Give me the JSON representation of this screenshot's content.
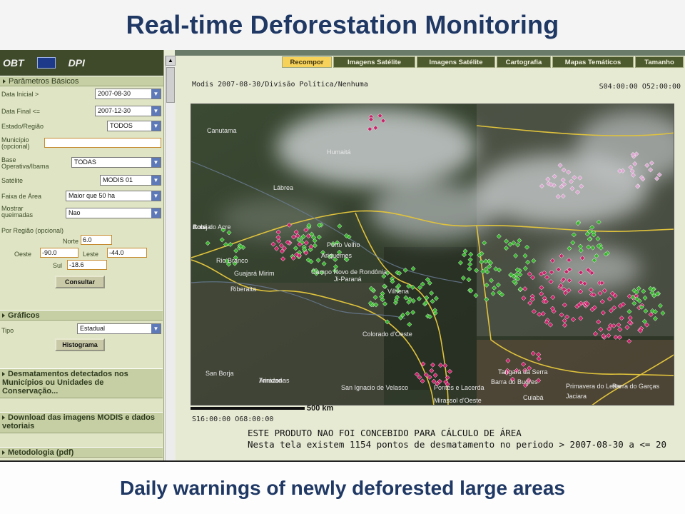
{
  "slide": {
    "title": "Real-time Deforestation Monitoring",
    "caption": "Daily warnings of newly deforested large areas"
  },
  "logos": [
    "OBT",
    "DPI"
  ],
  "left_panel": {
    "section_params": "Parâmetros Básicos",
    "fields": {
      "data_inicial_label": "Data Inicial  >",
      "data_inicial_value": "2007-08-30",
      "data_final_label": "Data Final  <=",
      "data_final_value": "2007-12-30",
      "estado_label": "Estado/Região",
      "estado_value": "TODOS",
      "municipio_label": "Município (opcional)",
      "municipio_value": "",
      "base_label": "Base Operativa/Ibama",
      "base_value": "TODAS",
      "satelite_label": "Satélite",
      "satelite_value": "MODIS 01",
      "faixa_label": "Faixa de Área",
      "faixa_value": "Maior que 50 ha",
      "mostrar_label": "Mostrar queimadas",
      "mostrar_value": "Nao",
      "regiao_label": "Por Região (opcional)",
      "norte_label": "Norte",
      "norte_value": "6.0",
      "oeste_label": "Oeste",
      "oeste_value": "-90.0",
      "leste_label": "Leste",
      "leste_value": "-44.0",
      "sul_label": "Sul",
      "sul_value": "-18.6"
    },
    "consultar_button": "Consultar",
    "section_graficos": "Gráficos",
    "tipo_label": "Tipo",
    "tipo_value": "Estadual",
    "histograma_button": "Histograma",
    "section_desmatamentos": "Desmatamentos detectados nos Municípios ou Unidades de Conservação...",
    "section_download": "Download das imagens MODIS e dados vetoriais",
    "section_metodologia": "Metodologia (pdf)"
  },
  "tabs": [
    "Recompor",
    "Imagens Satélite",
    "Imagens Satélite",
    "Cartografia",
    "Mapas Temáticos",
    "Tamanho"
  ],
  "active_tab": 0,
  "map": {
    "caption": "Modis 2007-08-30/Divisão Política/Nenhuma",
    "coord_top_right": "S04:00:00 O52:00:00",
    "coord_bottom_left": "S16:00:00 O68:00:00",
    "scale_label": "500 km",
    "places": [
      "Canutama",
      "Humaitá",
      "Lábrea",
      "Porto Velho",
      "Ariquemes",
      "Guajará Mirim",
      "Riberalta",
      "Campo Novo de Rondônia",
      "Ji-Paraná",
      "Vilhena",
      "Colorado d'Oeste",
      "Tangará da Serra",
      "San Borja",
      "Trinidad",
      "San Ignacio de Velasco",
      "Pontes e Lacerda",
      "Barra do Bugres",
      "Mirassol d'Oeste",
      "Cuiabá",
      "Primavera do Leste",
      "Barra do Garças",
      "Jaciara",
      "Trinidad",
      "Rio Branco",
      "Boca do Acre",
      "Trinidad",
      "Cobija",
      "Amazonas",
      "Acre"
    ],
    "warning": "ESTE PRODUTO NAO FOI CONCEBIDO PARA CÁLCULO DE ÁREA",
    "count_text": "Nesta tela existem 1154 pontos de desmatamento no periodo > 2007-08-30 a <= 20"
  },
  "colors": {
    "title": "#1f3864",
    "panel_bg": "#dfe5c4",
    "tab_active": "#f7d25a",
    "marker_new": "#c8246a",
    "marker_old": "#39b52e",
    "marker_light": "#d9a8cf",
    "border_line": "#e0c33c"
  }
}
